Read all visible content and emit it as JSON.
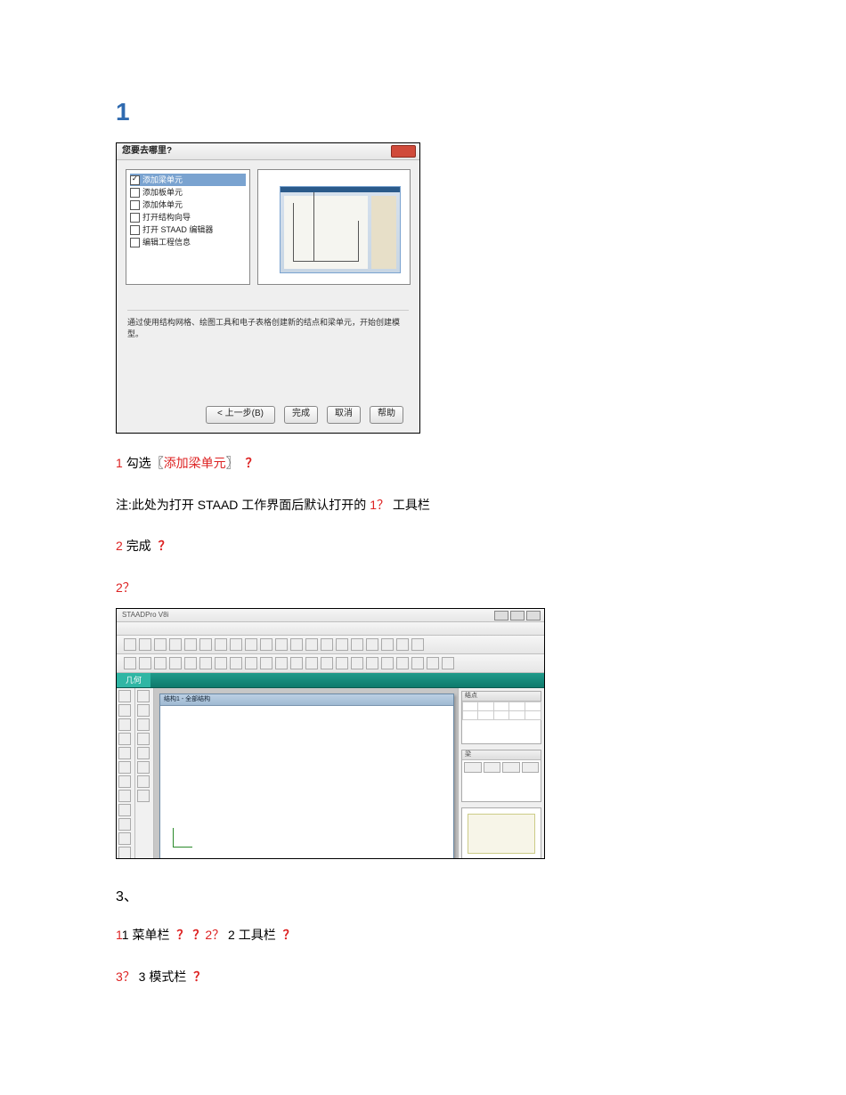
{
  "section1": "1",
  "dialog": {
    "title": "您要去哪里?",
    "options": [
      {
        "label": "添加梁单元",
        "checked": true,
        "selected": true
      },
      {
        "label": "添加板单元",
        "checked": false,
        "selected": false
      },
      {
        "label": "添加体单元",
        "checked": false,
        "selected": false
      },
      {
        "label": "打开结构向导",
        "checked": false,
        "selected": false
      },
      {
        "label": "打开 STAAD 编辑器",
        "checked": false,
        "selected": false
      },
      {
        "label": "编辑工程信息",
        "checked": false,
        "selected": false
      }
    ],
    "hint": "通过使用结构网格、绘图工具和电子表格创建新的结点和梁单元，开始创建模型。",
    "buttons": {
      "back": "< 上一步(B)",
      "finish": "完成",
      "cancel": "取消",
      "help": "帮助"
    }
  },
  "line1": {
    "num": "1",
    "text": "勾选〖",
    "hi": "添加梁单元",
    "tail": "〗",
    "q": "？"
  },
  "line_note": {
    "pre": "注:此处为打开 STAAD 工作界面后默认打开的 ",
    "num": "1？",
    "tail": " 工具栏"
  },
  "line2": {
    "num": "2",
    "text": "完成",
    "q": "？"
  },
  "line3": {
    "text": "2？"
  },
  "app": {
    "title": "STAADPro V8i",
    "doc_title": "结构1 - 全部结构",
    "mode_active": "几何",
    "panel_nodes": "结点",
    "panel_members": "梁"
  },
  "sec3": "3、",
  "line4": {
    "a": "1",
    "b": "1",
    "label1": " 菜单栏 ",
    "q1": "？",
    "q2": "？",
    "c": "2？",
    "d": " 2 工具栏 ",
    "q3": "？"
  },
  "line5": {
    "a": "3？",
    "b": " 3 模式栏 ",
    "q": "？"
  }
}
